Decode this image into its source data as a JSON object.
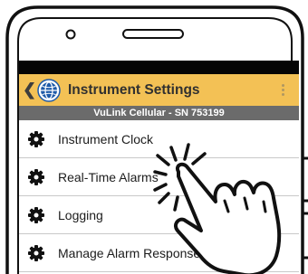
{
  "app": {
    "back_icon": "chevron-left-icon",
    "logo_icon": "globe-logo-icon",
    "title": "Instrument Settings",
    "menu_icon": "kebab-menu-icon",
    "device_label": "VuLink Cellular - SN 753199"
  },
  "menu": {
    "items": [
      {
        "label": "Instrument Clock",
        "icon": "gear-icon"
      },
      {
        "label": "Real-Time Alarms",
        "icon": "gear-icon"
      },
      {
        "label": "Logging",
        "icon": "gear-icon"
      },
      {
        "label": "Manage Alarm Responses",
        "icon": "gear-icon"
      }
    ]
  },
  "overlay": {
    "icon": "tap-hand-icon"
  },
  "colors": {
    "header_background": "#f3c155",
    "device_bar_background": "#6b6b6b",
    "status_bar": "#050505",
    "logo_blue": "#1d5aa8"
  }
}
